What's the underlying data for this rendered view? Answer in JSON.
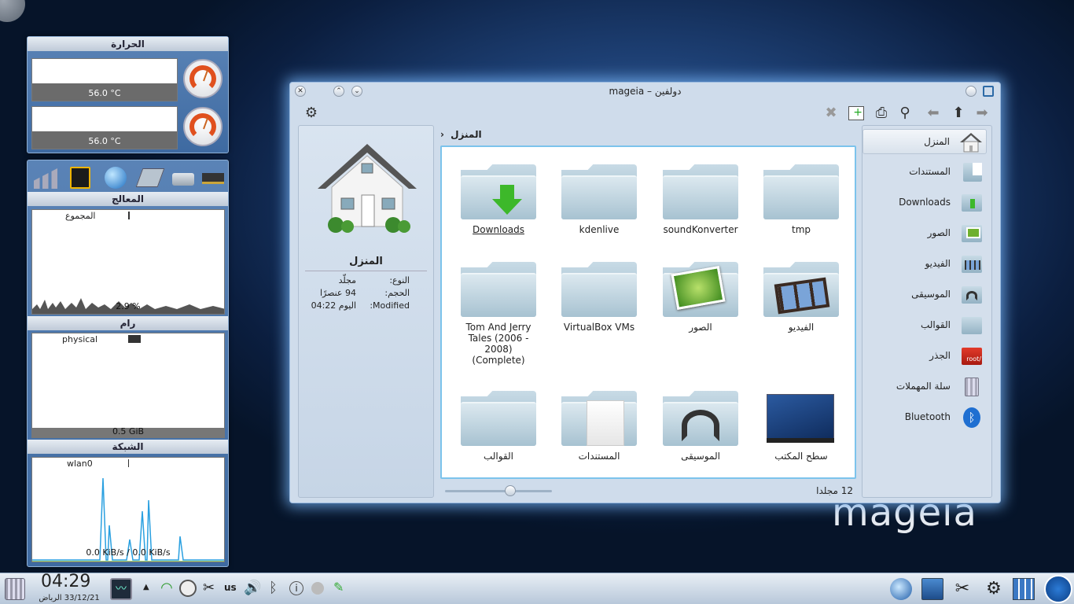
{
  "desktop": {
    "brand": "mageia"
  },
  "temp_widget": {
    "title": "الحرارة",
    "sensors": [
      {
        "value": "56.0 °C"
      },
      {
        "value": "56.0 °C"
      }
    ]
  },
  "sys_widget": {
    "cpu": {
      "title": "المعالج",
      "label": "المجموع",
      "value": "2.9 %"
    },
    "ram": {
      "title": "رام",
      "label": "physical",
      "value": "0.5 GiB"
    },
    "net": {
      "title": "الشبكة",
      "label": "wlan0",
      "value": "0.0 KiB/s / 0.0 KiB/s"
    }
  },
  "window": {
    "title": "mageia – دولفين",
    "breadcrumb": "المنزل",
    "info": {
      "name": "المنزل",
      "rows": [
        {
          "key": "النوع:",
          "val": "مجلّد"
        },
        {
          "key": "الحجم:",
          "val": "94 عنصرًا"
        },
        {
          "key": "Modified:",
          "val": "اليوم 04:22"
        }
      ]
    },
    "folders": [
      {
        "name": "Downloads",
        "icon": "download-folder-icon"
      },
      {
        "name": "kdenlive",
        "icon": "folder-icon"
      },
      {
        "name": "soundKonverter",
        "icon": "folder-icon"
      },
      {
        "name": "tmp",
        "icon": "folder-icon"
      },
      {
        "name": "Tom And Jerry Tales (2006 - 2008) (Complete)",
        "icon": "folder-icon"
      },
      {
        "name": "VirtualBox VMs",
        "icon": "folder-icon"
      },
      {
        "name": "الصور",
        "icon": "pictures-folder-icon"
      },
      {
        "name": "الفيديو",
        "icon": "video-folder-icon"
      },
      {
        "name": "القوالب",
        "icon": "folder-icon"
      },
      {
        "name": "المستندات",
        "icon": "documents-folder-icon"
      },
      {
        "name": "الموسيقى",
        "icon": "music-folder-icon"
      },
      {
        "name": "سطح المكتب",
        "icon": "desktop-icon"
      }
    ],
    "status": "12 مجلدا",
    "places": [
      {
        "label": "المنزل",
        "icon": "home-icon"
      },
      {
        "label": "المستندات",
        "icon": "documents-icon"
      },
      {
        "label": "Downloads",
        "icon": "downloads-icon"
      },
      {
        "label": "الصور",
        "icon": "pictures-icon"
      },
      {
        "label": "الفيديو",
        "icon": "video-icon"
      },
      {
        "label": "الموسيقى",
        "icon": "music-icon"
      },
      {
        "label": "القوالب",
        "icon": "templates-icon"
      },
      {
        "label": "الجذر",
        "icon": "root-icon"
      },
      {
        "label": "سلة المهملات",
        "icon": "trash-icon"
      },
      {
        "label": "Bluetooth",
        "icon": "bluetooth-icon"
      }
    ]
  },
  "taskbar": {
    "time": "04:29",
    "date": "33/12/21 الرباض",
    "kbd": "us"
  },
  "colors": {
    "accent": "#7cc3ec",
    "gauge": "#e0501e",
    "net_line": "#2aa0e0"
  }
}
